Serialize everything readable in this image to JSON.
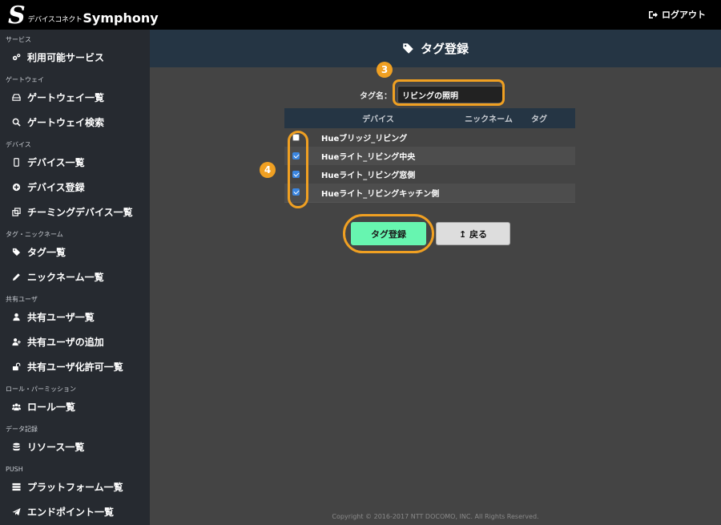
{
  "topbar": {
    "logo_mark": "S",
    "logo_jp": "デバイスコネクト",
    "logo_en": "Symphony",
    "logout_label": "ログアウト"
  },
  "sidebar": {
    "sections": [
      {
        "title": "サービス",
        "items": [
          {
            "label": "利用可能サービス",
            "icon": "cogs-icon"
          }
        ]
      },
      {
        "title": "ゲートウェイ",
        "items": [
          {
            "label": "ゲートウェイ一覧",
            "icon": "hdd-icon"
          },
          {
            "label": "ゲートウェイ検索",
            "icon": "search-icon"
          }
        ]
      },
      {
        "title": "デバイス",
        "items": [
          {
            "label": "デバイス一覧",
            "icon": "mobile-icon"
          },
          {
            "label": "デバイス登録",
            "icon": "plus-circle-icon"
          },
          {
            "label": "チーミングデバイス一覧",
            "icon": "clone-icon"
          }
        ]
      },
      {
        "title": "タグ・ニックネーム",
        "items": [
          {
            "label": "タグ一覧",
            "icon": "tags-icon"
          },
          {
            "label": "ニックネーム一覧",
            "icon": "pencil-icon"
          }
        ]
      },
      {
        "title": "共有ユーザ",
        "items": [
          {
            "label": "共有ユーザ一覧",
            "icon": "user-icon"
          },
          {
            "label": "共有ユーザの追加",
            "icon": "user-plus-icon"
          },
          {
            "label": "共有ユーザ化許可一覧",
            "icon": "unlock-icon"
          }
        ]
      },
      {
        "title": "ロール・パーミッション",
        "items": [
          {
            "label": "ロール一覧",
            "icon": "users-icon"
          }
        ]
      },
      {
        "title": "データ記録",
        "items": [
          {
            "label": "リソース一覧",
            "icon": "database-icon"
          }
        ]
      },
      {
        "title": "PUSH",
        "items": [
          {
            "label": "プラットフォーム一覧",
            "icon": "server-icon"
          },
          {
            "label": "エンドポイント一覧",
            "icon": "paper-plane-icon"
          }
        ]
      }
    ]
  },
  "main": {
    "header_title": "タグ登録",
    "tag_label": "タグ名：",
    "tag_value": "リビングの照明",
    "annotation_3": "3",
    "annotation_4": "4",
    "table": {
      "headers": {
        "device": "デバイス",
        "nickname": "ニックネーム",
        "tag": "タグ"
      },
      "rows": [
        {
          "device": "Hueブリッジ_リビング",
          "checked": false
        },
        {
          "device": "Hueライト_リビング中央",
          "checked": true
        },
        {
          "device": "Hueライト_リビング窓側",
          "checked": true
        },
        {
          "device": "Hueライト_リビングキッチン側",
          "checked": true
        }
      ]
    },
    "register_label": "タグ登録",
    "back_label": "↥ 戻る",
    "footer": "Copyright © 2016-2017 NTT DOCOMO, INC. All Rights Reserved."
  },
  "colors": {
    "highlight": "#f0a022",
    "register_button": "#67f5b0",
    "header_bg": "#253544",
    "checkbox_checked": "#3b86e0"
  }
}
